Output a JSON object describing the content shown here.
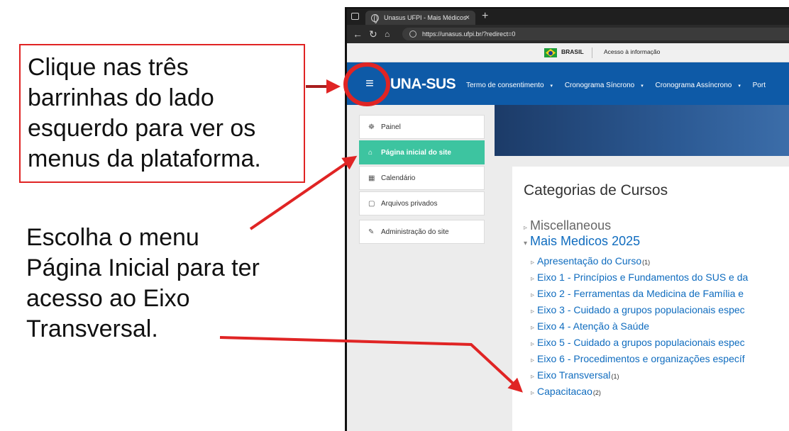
{
  "annotations": {
    "callout_text": "Clique nas três\nbarrinhas do lado\nesquerdo para ver os\nmenus da plataforma.",
    "note_text": "Escolha o menu\nPágina Inicial para ter\nacesso ao Eixo\nTransversal.",
    "accent_color": "#e02424"
  },
  "browser": {
    "tab_title": "Unasus UFPI - Mais Médicos",
    "tab_close": "×",
    "new_tab": "+",
    "url": "https://unasus.ufpi.br/?redirect=0"
  },
  "gov_bar": {
    "country": "BRASIL",
    "access_info": "Acesso à informação"
  },
  "navbar": {
    "menu_icon": "≡",
    "brand": "UNA-SUS",
    "items": [
      "Termo de consentimento",
      "Cronograma Síncrono",
      "Cronograma Assíncrono",
      "Port"
    ],
    "caret": "▾",
    "color": "#0e5aa7"
  },
  "sidebar": {
    "items": [
      {
        "label": "Painel",
        "icon": "dashboard-icon",
        "glyph": "☸"
      },
      {
        "label": "Página inicial do site",
        "icon": "home-icon",
        "glyph": "⌂",
        "active": true
      },
      {
        "label": "Calendário",
        "icon": "calendar-icon",
        "glyph": "▦"
      },
      {
        "label": "Arquivos privados",
        "icon": "file-icon",
        "glyph": "▢"
      },
      {
        "label": "Administração do site",
        "icon": "wrench-icon",
        "glyph": "✎"
      }
    ],
    "active_color": "#3dc4a0"
  },
  "main": {
    "title": "Categorias de Cursos",
    "categories": [
      {
        "label": "Miscellaneous",
        "expanded": false
      },
      {
        "label": "Mais Medicos 2025",
        "expanded": true,
        "children": [
          {
            "label": "Apresentação do Curso",
            "count": "(1)"
          },
          {
            "label": "Eixo 1 - Princípios e Fundamentos do SUS e da",
            "count": ""
          },
          {
            "label": "Eixo 2 - Ferramentas da Medicina de Família e",
            "count": ""
          },
          {
            "label": "Eixo 3 - Cuidado a grupos populacionais espec",
            "count": ""
          },
          {
            "label": "Eixo 4 - Atenção à Saúde",
            "count": ""
          },
          {
            "label": "Eixo 5 - Cuidado a grupos populacionais espec",
            "count": ""
          },
          {
            "label": "Eixo 6 - Procedimentos e organizações específ",
            "count": ""
          },
          {
            "label": "Eixo Transversal",
            "count": "(1)"
          },
          {
            "label": "Capacitacao",
            "count": "(2)"
          }
        ]
      }
    ],
    "glyph_collapsed": "▹",
    "glyph_expanded": "▾"
  }
}
